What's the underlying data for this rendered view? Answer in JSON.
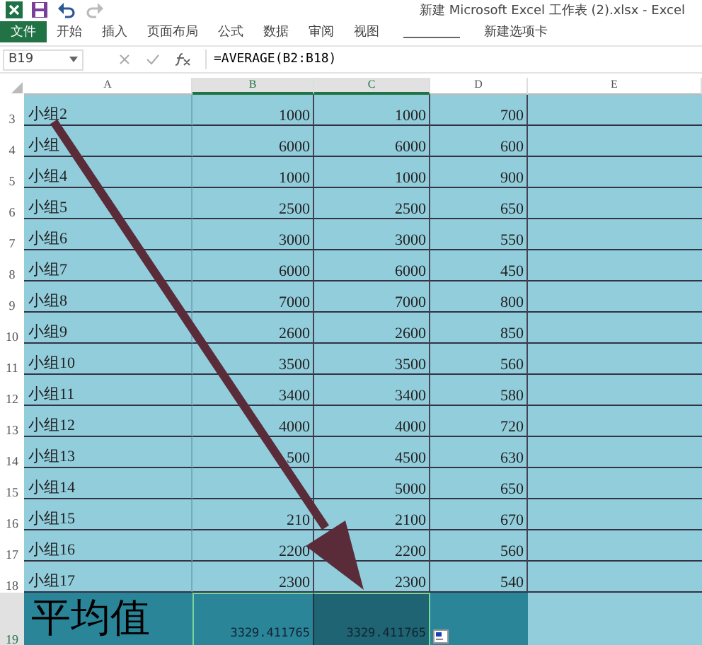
{
  "window": {
    "title": "新建 Microsoft Excel 工作表 (2).xlsx - Excel"
  },
  "ribbon_tabs": [
    {
      "label": "文件",
      "kind": "file",
      "selected": false
    },
    {
      "label": "开始",
      "kind": "tab",
      "selected": false
    },
    {
      "label": "插入",
      "kind": "tab",
      "selected": false
    },
    {
      "label": "页面布局",
      "kind": "tab",
      "selected": false
    },
    {
      "label": "公式",
      "kind": "tab",
      "selected": false
    },
    {
      "label": "数据",
      "kind": "tab",
      "selected": false
    },
    {
      "label": "审阅",
      "kind": "tab",
      "selected": false
    },
    {
      "label": "视图",
      "kind": "tab",
      "selected": false
    },
    {
      "label": "新建选项卡",
      "kind": "tab",
      "selected": false
    }
  ],
  "formula_bar": {
    "name_box": "B19",
    "formula": "=AVERAGE(B2:B18)"
  },
  "columns": [
    {
      "label": "A",
      "selected": false
    },
    {
      "label": "B",
      "selected": true
    },
    {
      "label": "C",
      "selected": true
    },
    {
      "label": "D",
      "selected": false
    },
    {
      "label": "E",
      "selected": false
    }
  ],
  "rows": [
    {
      "number": "3",
      "a": "小组2",
      "b": "1000",
      "c": "1000",
      "d": "700"
    },
    {
      "number": "4",
      "a": "小组",
      "b": "6000",
      "c": "6000",
      "d": "600"
    },
    {
      "number": "5",
      "a": "小组4",
      "b": "1000",
      "c": "1000",
      "d": "900"
    },
    {
      "number": "6",
      "a": "小组5",
      "b": "2500",
      "c": "2500",
      "d": "650"
    },
    {
      "number": "7",
      "a": "小组6",
      "b": "3000",
      "c": "3000",
      "d": "550"
    },
    {
      "number": "8",
      "a": "小组7",
      "b": "6000",
      "c": "6000",
      "d": "450"
    },
    {
      "number": "9",
      "a": "小组8",
      "b": "7000",
      "c": "7000",
      "d": "800"
    },
    {
      "number": "10",
      "a": "小组9",
      "b": "2600",
      "c": "2600",
      "d": "850"
    },
    {
      "number": "11",
      "a": "小组10",
      "b": "3500",
      "c": "3500",
      "d": "560"
    },
    {
      "number": "12",
      "a": "小组11",
      "b": "3400",
      "c": "3400",
      "d": "580"
    },
    {
      "number": "13",
      "a": "小组12",
      "b": "4000",
      "c": "4000",
      "d": "720"
    },
    {
      "number": "14",
      "a": "小组13",
      "b": "500",
      "c": "4500",
      "d": "630"
    },
    {
      "number": "15",
      "a": "小组14",
      "c": "5000",
      "d": "650"
    },
    {
      "number": "16",
      "a": "小组15",
      "b": "210",
      "c": "2100",
      "d": "670"
    },
    {
      "number": "17",
      "a": "小组16",
      "b": "2200",
      "c": "2200",
      "d": "560"
    },
    {
      "number": "18",
      "a": "小组17",
      "b": "2300",
      "c": "2300",
      "d": "540"
    }
  ],
  "total_row": {
    "number": "19",
    "label": "平均值",
    "b": "3329.411765",
    "c": "3329.411765",
    "selected": true
  }
}
